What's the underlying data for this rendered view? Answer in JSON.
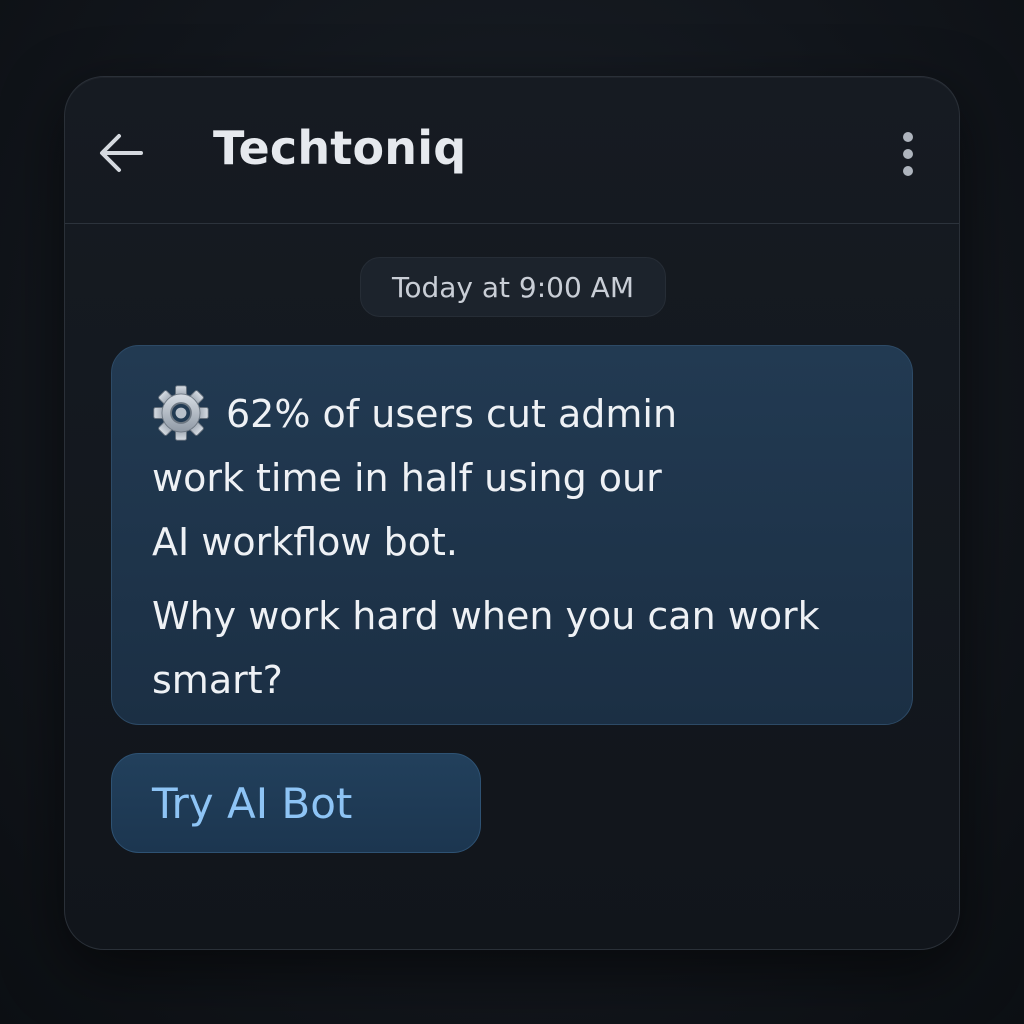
{
  "header": {
    "title": "Techtoniq",
    "back_icon": "arrow-left-icon",
    "menu_icon": "more-vertical-icon"
  },
  "timestamp": "Today at 9:00 AM",
  "message": {
    "icon": "gear-icon",
    "lines": [
      "62% of users cut admin",
      "work time in half using our",
      "AI workflow bot.",
      "Why work hard when you can work",
      "smart?"
    ]
  },
  "cta": {
    "label": "Try AI Bot"
  },
  "colors": {
    "background": "#12161c",
    "card": "#161b22",
    "bubble": "#223a52",
    "cta_text": "#8ec4f5",
    "text": "#eef1f5"
  }
}
